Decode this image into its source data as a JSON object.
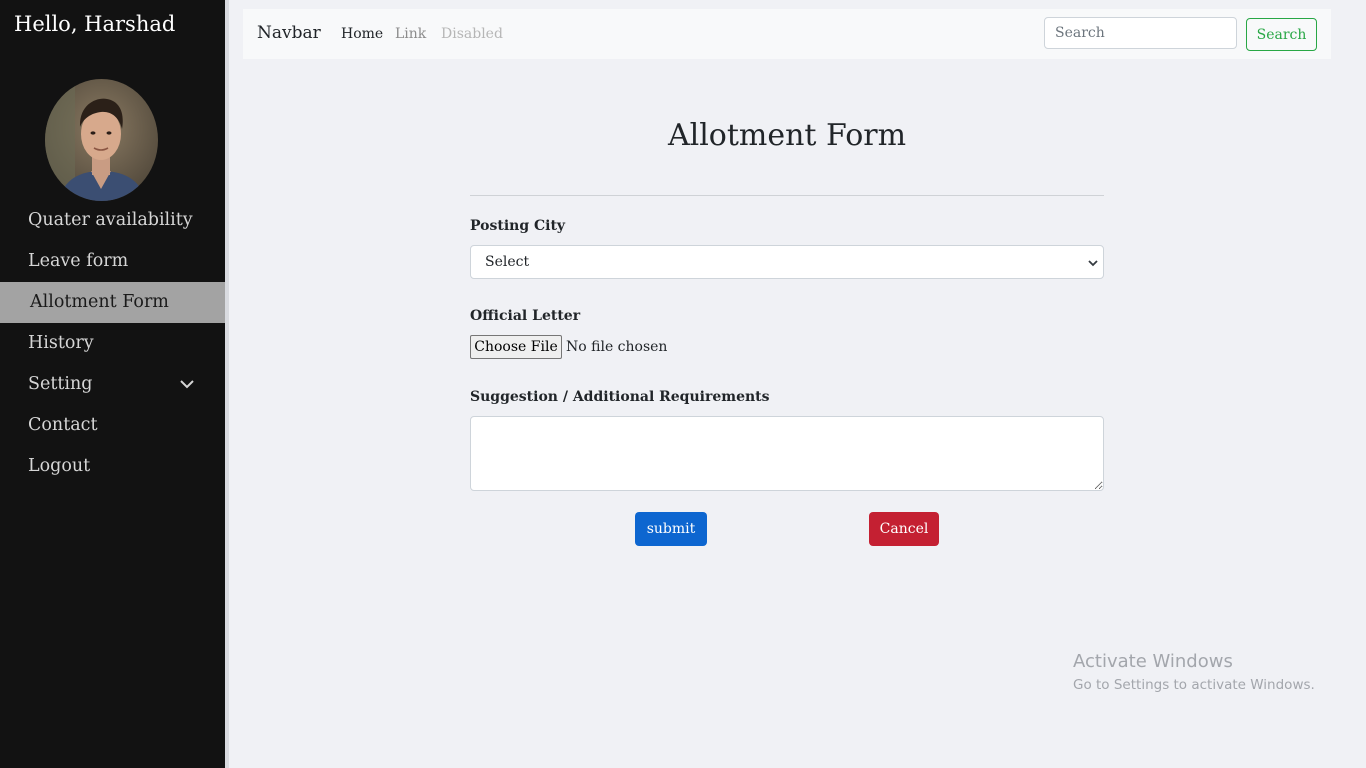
{
  "sidebar": {
    "greeting": "Hello, Harshad",
    "items": [
      {
        "label": "Quater availability"
      },
      {
        "label": "Leave form"
      },
      {
        "label": "Allotment Form"
      },
      {
        "label": "History"
      },
      {
        "label": "Setting"
      },
      {
        "label": "Contact"
      },
      {
        "label": "Logout"
      }
    ],
    "active_item": "Allotment Form"
  },
  "navbar": {
    "brand": "Navbar",
    "links": {
      "home": "Home",
      "link": "Link",
      "disabled": "Disabled"
    },
    "search": {
      "placeholder": "Search",
      "button_label": "Search"
    }
  },
  "form": {
    "title": "Allotment Form",
    "posting_city": {
      "label": "Posting City",
      "selected": "Select"
    },
    "official_letter": {
      "label": "Official Letter",
      "button_label": "Choose File",
      "status": "No file chosen"
    },
    "suggestion": {
      "label": "Suggestion / Additional Requirements",
      "value": ""
    },
    "submit_label": "submit",
    "cancel_label": "Cancel"
  },
  "watermark": {
    "line1": "Activate Windows",
    "line2": "Go to Settings to activate Windows."
  },
  "colors": {
    "sidebar_bg": "#121212",
    "active_item_bg": "#a3a3a3",
    "submit": "#0d66d0",
    "cancel": "#c42032",
    "search_outline": "#28a745"
  }
}
